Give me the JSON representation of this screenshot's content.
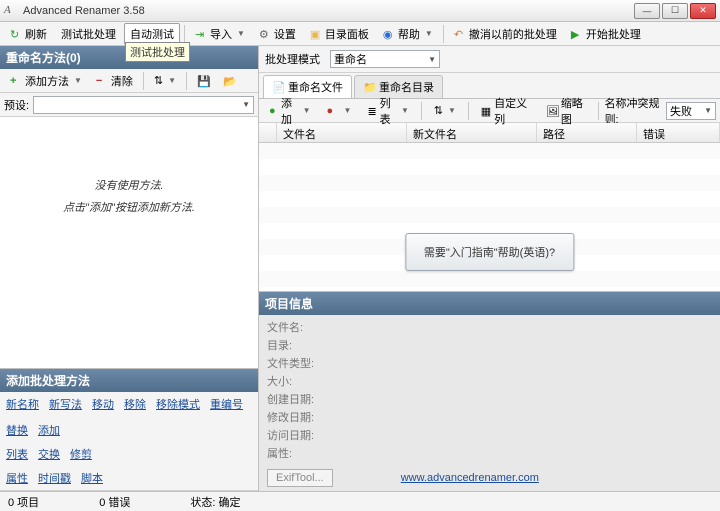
{
  "title": "Advanced Renamer 3.58",
  "toolbar": {
    "refresh": "刷新",
    "test_batch": "测试批处理",
    "auto_test": "自动测试",
    "auto_test_tooltip": "测试批处理",
    "import": "导入",
    "settings": "设置",
    "dir_panel": "目录面板",
    "help": "帮助",
    "undo_batch": "撤消以前的批处理",
    "start_batch": "开始批处理"
  },
  "left": {
    "header": "重命名方法(0)",
    "add_method": "添加方法",
    "clear": "清除",
    "preset_label": "预设:",
    "empty1": "没有使用方法.",
    "empty2": "点击\"添加\"按钮添加新方法.",
    "add_header": "添加批处理方法",
    "links1": [
      "新名称",
      "新写法",
      "移动",
      "移除",
      "移除模式",
      "重编号",
      "替换",
      "添加"
    ],
    "links2": [
      "列表",
      "交换",
      "修剪"
    ],
    "links3": [
      "属性",
      "时间戳",
      "脚本"
    ]
  },
  "right": {
    "mode_label": "批处理模式",
    "mode_value": "重命名",
    "tab_files": "重命名文件",
    "tab_dirs": "重命名目录",
    "ft": {
      "add": "添加",
      "list": "列表",
      "custom_cols": "自定义列",
      "thumbs": "缩略图",
      "conflict_label": "名称冲突规则:",
      "conflict_value": "失败"
    },
    "cols": {
      "filename": "文件名",
      "newname": "新文件名",
      "path": "路径",
      "error": "错误"
    },
    "help_button": "需要\"入门指南\"帮助(英语)?",
    "info_header": "项目信息",
    "info": {
      "filename": "文件名:",
      "dir": "目录:",
      "type": "文件类型:",
      "size": "大小:",
      "created": "创建日期:",
      "modified": "修改日期:",
      "accessed": "访问日期:",
      "attrs": "属性:"
    },
    "exif": "ExifTool..."
  },
  "status": {
    "items": "0 项目",
    "errors": "0 错误",
    "state": "状态: 确定",
    "url": "www.advancedrenamer.com"
  }
}
